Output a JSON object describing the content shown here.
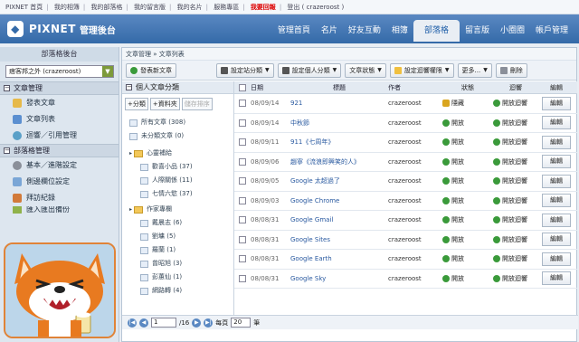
{
  "toplinks": [
    "PIXNET 首頁",
    "我的相簿",
    "我的部落格",
    "我的留言版",
    "我的名片",
    "服務專區",
    "我要回報",
    "登出 ( crazeroost )"
  ],
  "app": {
    "brand": "PIXNET",
    "subtitle": "管理後台"
  },
  "nav": [
    "管理首頁",
    "名片",
    "好友互動",
    "相簿",
    "部落格",
    "留言版",
    "小圈圈",
    "帳戶管理"
  ],
  "nav_active": "部落格",
  "sidebar": {
    "title": "部落格後台",
    "blog_select": "痞客邦之外 (crazeroost)",
    "sections": [
      {
        "title": "文章管理",
        "items": [
          "發表文章",
          "文章列表",
          "迴響／引用管理"
        ]
      },
      {
        "title": "部落格管理",
        "items": [
          "基本／進階設定",
          "側邊欄位設定",
          "拜訪紀錄"
        ]
      }
    ],
    "cut_item": "匯入匯出備份"
  },
  "breadcrumb": "文章管理 » 文章列表",
  "toolbar": {
    "new_post": "發表新文章",
    "site_category": "設定站分類",
    "personal_category": "設定個人分類",
    "status": "文章狀態",
    "comment_permission": "設定迴響權限",
    "more": "更多...",
    "delete": "刪除"
  },
  "categories": {
    "header": "個人文章分類",
    "btn_add_category": "+分類",
    "btn_add_folder": "+資料夾",
    "btn_save_order": "儲存排序",
    "all": "所有文章 (308)",
    "uncategorized": "未分類文章 (0)",
    "folders": [
      {
        "name": "心靈補給",
        "children": [
          "歡喜小品 (37)",
          "人際關係 (11)",
          "七情六慾 (37)"
        ]
      },
      {
        "name": "作家專欄",
        "children": [
          "戴晨志 (6)",
          "劉墉 (5)",
          "羅蘭 (1)",
          "曾昭旭 (3)",
          "彭蕙仙 (1)",
          "網路轉 (4)"
        ]
      }
    ]
  },
  "table": {
    "headers": {
      "date": "日期",
      "title": "標題",
      "author": "作者",
      "status": "狀態",
      "comment": "迴響",
      "edit": "編輯"
    },
    "rows": [
      {
        "date": "08/09/14",
        "title": "921",
        "author": "crazeroost",
        "status": "隱藏",
        "status_icon": "lock",
        "comment": "開放迴響",
        "edit": "編輯"
      },
      {
        "date": "08/09/14",
        "title": "中秋節",
        "author": "crazeroost",
        "status": "開放",
        "status_icon": "ok",
        "comment": "開放迴響",
        "edit": "編輯"
      },
      {
        "date": "08/09/11",
        "title": "911《七周年》",
        "author": "crazeroost",
        "status": "開放",
        "status_icon": "ok",
        "comment": "開放迴響",
        "edit": "編輯"
      },
      {
        "date": "08/09/06",
        "title": "趙寧《流浪即興笑的人》",
        "author": "crazeroost",
        "status": "開放",
        "status_icon": "ok",
        "comment": "開放迴響",
        "edit": "編輯"
      },
      {
        "date": "08/09/05",
        "title": "Google 太超過了",
        "author": "crazeroost",
        "status": "開放",
        "status_icon": "ok",
        "comment": "開放迴響",
        "edit": "編輯"
      },
      {
        "date": "08/09/03",
        "title": "Google Chrome",
        "author": "crazeroost",
        "status": "開放",
        "status_icon": "ok",
        "comment": "開放迴響",
        "edit": "編輯"
      },
      {
        "date": "08/08/31",
        "title": "Google Gmail",
        "author": "crazeroost",
        "status": "開放",
        "status_icon": "ok",
        "comment": "開放迴響",
        "edit": "編輯"
      },
      {
        "date": "08/08/31",
        "title": "Google Sites",
        "author": "crazeroost",
        "status": "開放",
        "status_icon": "ok",
        "comment": "開放迴響",
        "edit": "編輯"
      },
      {
        "date": "08/08/31",
        "title": "Google Earth",
        "author": "crazeroost",
        "status": "開放",
        "status_icon": "ok",
        "comment": "開放迴響",
        "edit": "編輯"
      },
      {
        "date": "08/08/31",
        "title": "Google Sky",
        "author": "crazeroost",
        "status": "開放",
        "status_icon": "ok",
        "comment": "開放迴響",
        "edit": "編輯"
      }
    ]
  },
  "pager": {
    "page_value": "1",
    "total": "/16",
    "per_page_label": "每頁",
    "per_page": "20",
    "unit": "筆"
  },
  "colors": {
    "header": "#346aa8",
    "accent_orange": "#e08338",
    "ok_green": "#3a9a3a",
    "hot_red": "#dd0000"
  }
}
